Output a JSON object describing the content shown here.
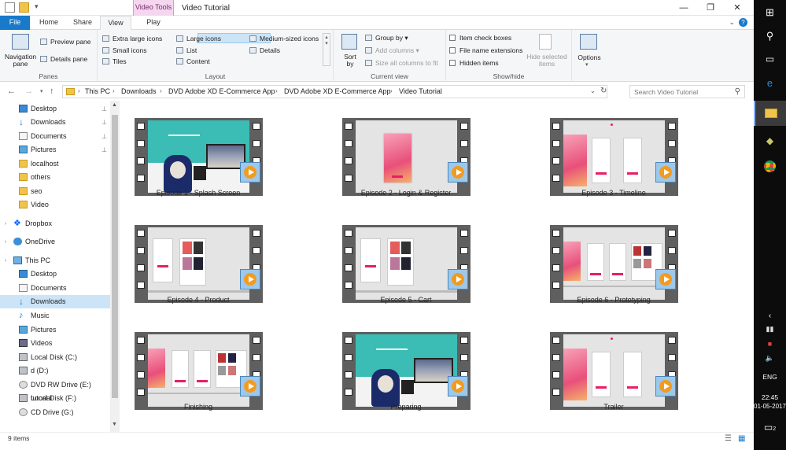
{
  "window": {
    "title": "Video Tutorial",
    "context_group": "Video Tools",
    "controls": {
      "minimize": "—",
      "maximize": "❐",
      "close": "✕"
    }
  },
  "tabs": {
    "file": "File",
    "home": "Home",
    "share": "Share",
    "view": "View",
    "play": "Play",
    "help": "?"
  },
  "ribbon": {
    "panes": {
      "label": "Panes",
      "navigation_pane": "Navigation pane",
      "preview_pane": "Preview pane",
      "details_pane": "Details pane"
    },
    "layout": {
      "label": "Layout",
      "items": [
        "Extra large icons",
        "Large icons",
        "Medium-sized icons",
        "Small icons",
        "List",
        "Details",
        "Tiles",
        "Content"
      ],
      "selected": "Extra large icons"
    },
    "current_view": {
      "label": "Current view",
      "sort_by": "Sort by",
      "group_by": "Group by",
      "add_columns": "Add columns",
      "size_columns": "Size all columns to fit"
    },
    "show_hide": {
      "label": "Show/hide",
      "item_check_boxes": "Item check boxes",
      "file_name_extensions": "File name extensions",
      "hidden_items": "Hidden items",
      "hide_selected": "Hide selected items"
    },
    "options": {
      "label": "Options"
    }
  },
  "address": {
    "crumbs": [
      "This PC",
      "Downloads",
      "DVD Adobe XD E-Commerce App",
      "DVD Adobe XD E-Commerce App",
      "Video Tutorial"
    ],
    "search_placeholder": "Search Video Tutorial"
  },
  "nav": {
    "items": [
      {
        "label": "Desktop",
        "icon": "desktop-icon",
        "pinned": true
      },
      {
        "label": "Downloads",
        "icon": "downloads-icon",
        "pinned": true
      },
      {
        "label": "Documents",
        "icon": "documents-icon",
        "pinned": true
      },
      {
        "label": "Pictures",
        "icon": "pictures-icon",
        "pinned": true
      },
      {
        "label": "localhost",
        "icon": "folder-icon"
      },
      {
        "label": "others",
        "icon": "folder-icon"
      },
      {
        "label": "seo",
        "icon": "folder-icon"
      },
      {
        "label": "Video",
        "icon": "folder-icon"
      },
      {
        "label": "Dropbox",
        "icon": "dropbox-icon"
      },
      {
        "label": "OneDrive",
        "icon": "onedrive-icon"
      },
      {
        "label": "This PC",
        "icon": "pc-icon"
      },
      {
        "label": "Desktop",
        "icon": "desktop-icon"
      },
      {
        "label": "Documents",
        "icon": "documents-icon"
      },
      {
        "label": "Downloads",
        "icon": "downloads-icon",
        "selected": true
      },
      {
        "label": "Music",
        "icon": "music-icon"
      },
      {
        "label": "Pictures",
        "icon": "pictures-icon"
      },
      {
        "label": "Videos",
        "icon": "videos-icon"
      },
      {
        "label": "Local Disk (C:)",
        "icon": "disk-icon"
      },
      {
        "label": "d (D:)",
        "icon": "disk-icon"
      },
      {
        "label": "DVD RW Drive (E:) tutorial",
        "icon": "dvd-icon"
      },
      {
        "label": "Local Disk (F:)",
        "icon": "disk-icon"
      },
      {
        "label": "CD Drive (G:)",
        "icon": "dvd-icon"
      }
    ]
  },
  "files": [
    {
      "name": "Episode 1 - Splash Screen",
      "thumb": "room"
    },
    {
      "name": "Episode 2 - Login & Register",
      "thumb": "single"
    },
    {
      "name": "Episode 3 - Timeline",
      "thumb": "three"
    },
    {
      "name": "Episode 4 - Product",
      "thumb": "two"
    },
    {
      "name": "Episode 5 - Cart",
      "thumb": "two"
    },
    {
      "name": "Episode 6 - Prototyping",
      "thumb": "four"
    },
    {
      "name": "Finishing",
      "thumb": "four"
    },
    {
      "name": "Preparing",
      "thumb": "room"
    },
    {
      "name": "Trailer",
      "thumb": "three"
    }
  ],
  "status": {
    "count": "9 items"
  },
  "taskbar": {
    "language": "ENG",
    "time": "22:45",
    "date": "01-05-2017",
    "notifications": "2"
  },
  "colors": {
    "file_tab": "#1979ca",
    "context_tab": "#f4d6ef",
    "selection": "#cce4f7",
    "accent_pink": "#e91e63",
    "film_gray": "#5f5f5f",
    "play_orange": "#f29b1f"
  }
}
